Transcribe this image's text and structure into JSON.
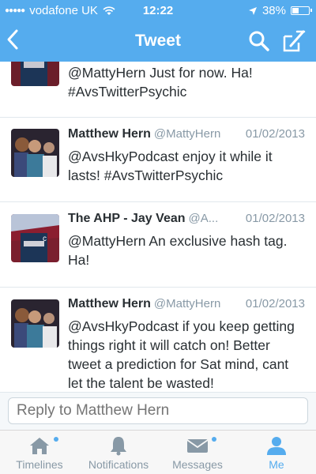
{
  "status_bar": {
    "carrier": "vodafone UK",
    "time": "12:22",
    "battery": "38%",
    "battery_level": 0.38
  },
  "nav": {
    "title": "Tweet",
    "back_icon": "chevron-left-icon",
    "search_icon": "search-icon",
    "compose_icon": "compose-icon"
  },
  "tweets": [
    {
      "name": "",
      "handle": "",
      "date": "",
      "text_lines": [
        "@MattyHern Just for now. Ha!",
        "#AvsTwitterPsychic"
      ]
    },
    {
      "name": "Matthew Hern",
      "handle": "@MattyHern",
      "date": "01/02/2013",
      "text_lines": [
        "@AvsHkyPodcast enjoy it while it",
        "lasts! #AvsTwitterPsychic"
      ]
    },
    {
      "name": "The AHP - Jay Vean",
      "handle": "@A...",
      "date": "01/02/2013",
      "text_lines": [
        "@MattyHern An exclusive hash tag.",
        "Ha!"
      ]
    },
    {
      "name": "Matthew Hern",
      "handle": "@MattyHern",
      "date": "01/02/2013",
      "text_lines": [
        "@AvsHkyPodcast if you keep getting",
        "things right it will catch on! Better",
        "tweet a prediction for Sat mind, cant",
        "let the talent be wasted!"
      ]
    }
  ],
  "reply": {
    "placeholder": "Reply to Matthew Hern"
  },
  "tabs": [
    {
      "label": "Timelines",
      "icon": "home-icon",
      "active": false
    },
    {
      "label": "Notifications",
      "icon": "bell-icon",
      "active": false
    },
    {
      "label": "Messages",
      "icon": "envelope-icon",
      "active": false
    },
    {
      "label": "Me",
      "icon": "person-icon",
      "active": true
    }
  ],
  "colors": {
    "accent": "#55acee",
    "text": "#292f33",
    "muted": "#8899a6"
  }
}
